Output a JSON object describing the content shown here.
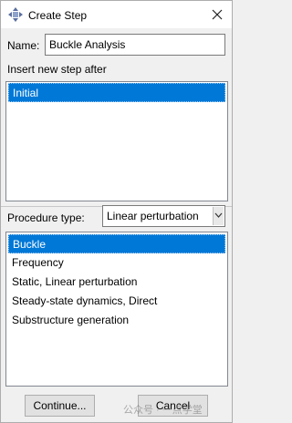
{
  "window": {
    "title": "Create Step",
    "title_icon": "step-diamond-icon",
    "close_icon": "close-icon"
  },
  "name": {
    "label": "Name:",
    "value": "Buckle Analysis"
  },
  "insert_after": {
    "label": "Insert new step after",
    "items": [
      "Initial"
    ],
    "selected_index": 0
  },
  "procedure": {
    "label": "Procedure type:",
    "selected": "Linear perturbation",
    "items": [
      "Buckle",
      "Frequency",
      "Static, Linear perturbation",
      "Steady-state dynamics, Direct",
      "Substructure generation"
    ],
    "selected_index": 0
  },
  "buttons": {
    "continue": "Continue...",
    "cancel": "Cancel"
  },
  "watermark": "公众号 · 一点学堂",
  "colors": {
    "selection": "#0078d7",
    "dialog_bg": "#f0f0f0",
    "icon_accent": "#5a6ea0"
  }
}
